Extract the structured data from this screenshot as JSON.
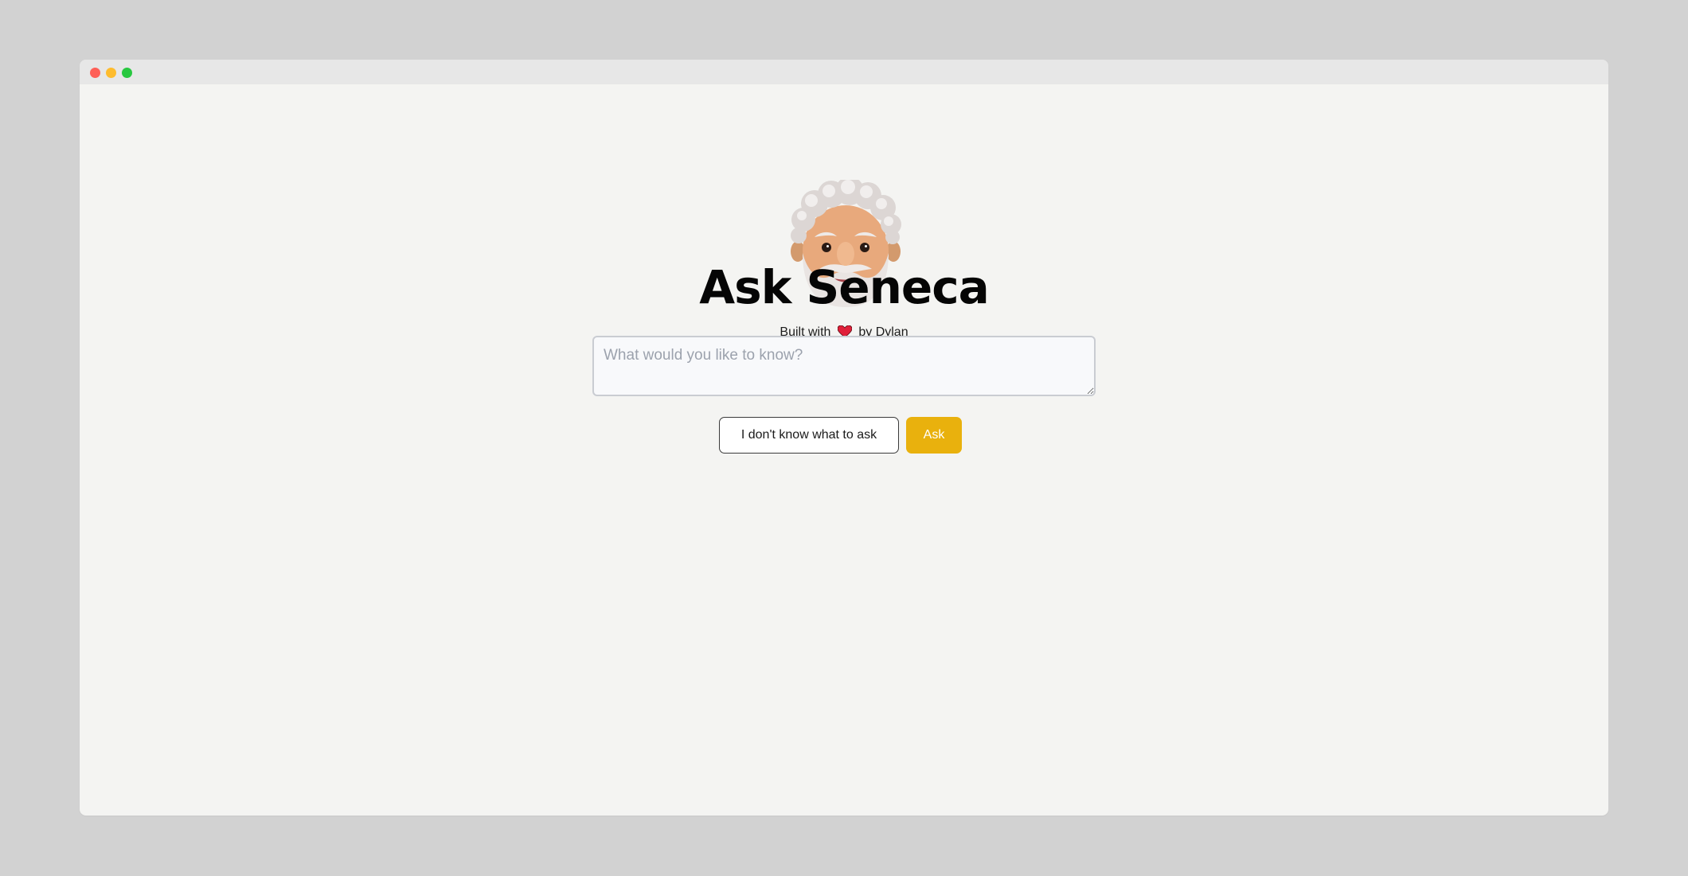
{
  "app": {
    "title": "Ask Seneca",
    "avatar_icon": "bearded-philosopher-memoji-icon",
    "subtitle": {
      "prefix": "Built with",
      "icon": "heart-icon",
      "suffix": "by Dylan"
    }
  },
  "question": {
    "value": "",
    "placeholder": "What would you like to know?"
  },
  "actions": {
    "dont_know_label": "I don't know what to ask",
    "ask_label": "Ask"
  },
  "colors": {
    "accent": "#e9b10d",
    "background": "#f4f4f2",
    "heart": "#e0203a"
  }
}
